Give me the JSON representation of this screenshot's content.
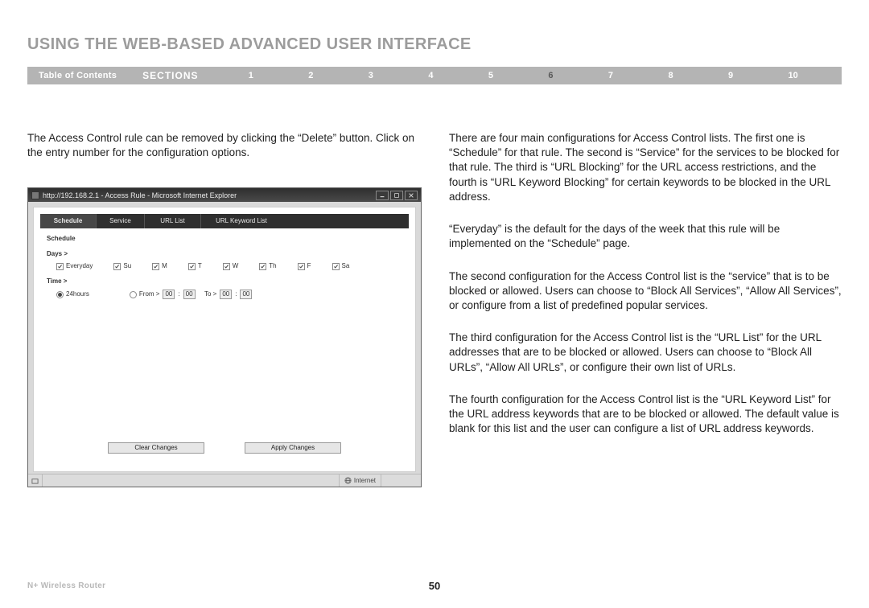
{
  "title": "USING THE WEB-BASED ADVANCED USER INTERFACE",
  "nav": {
    "toc": "Table of Contents",
    "sections_label": "SECTIONS",
    "numbers": [
      "1",
      "2",
      "3",
      "4",
      "5",
      "6",
      "7",
      "8",
      "9",
      "10"
    ],
    "active_index": 5
  },
  "left_col": {
    "p1": "The Access Control rule can be removed by clicking the “Delete” button. Click on the entry number for the configuration options."
  },
  "right_col": {
    "p1": "There are four main configurations for Access Control lists. The first one is “Schedule” for that rule. The second is “Service” for the services to be blocked for that rule. The third is “URL Blocking” for the URL access restrictions, and the fourth is “URL Keyword Blocking” for certain keywords to be blocked in the URL address.",
    "p2": "“Everyday” is the default for the days of the week that this rule will be implemented on the “Schedule” page.",
    "p3": "The second configuration for the Access Control list is the “service” that is to be blocked or allowed. Users can choose to “Block All Services”, “Allow All Services”, or configure from a list of predefined popular services.",
    "p4": "The third configuration for the Access Control list is the “URL List” for the URL addresses that are to be blocked or allowed. Users can choose to “Block All URLs”, “Allow All URLs”, or configure their own list of URLs.",
    "p5": "The fourth configuration for the Access Control list is the “URL Keyword List” for the URL address keywords that are to be blocked or allowed. The default value is blank for this list and the user can configure a list of URL address keywords."
  },
  "browser": {
    "title": "http://192.168.2.1 - Access Rule - Microsoft Internet Explorer",
    "tabs": {
      "schedule": "Schedule",
      "service": "Service",
      "urllist": "URL List",
      "urlkw": "URL Keyword List"
    },
    "panel": {
      "heading": "Schedule",
      "days_label": "Days >",
      "everyday": "Everyday",
      "days": [
        "Su",
        "M",
        "T",
        "W",
        "Th",
        "F",
        "Sa"
      ],
      "time_label": "Time >",
      "t24": "24hours",
      "from_label": "From >",
      "to_label": "To >",
      "sel": "00"
    },
    "buttons": {
      "clear": "Clear Changes",
      "apply": "Apply Changes"
    },
    "status": {
      "zone": "Internet"
    }
  },
  "footer": {
    "product": "N+ Wireless Router",
    "page": "50"
  }
}
